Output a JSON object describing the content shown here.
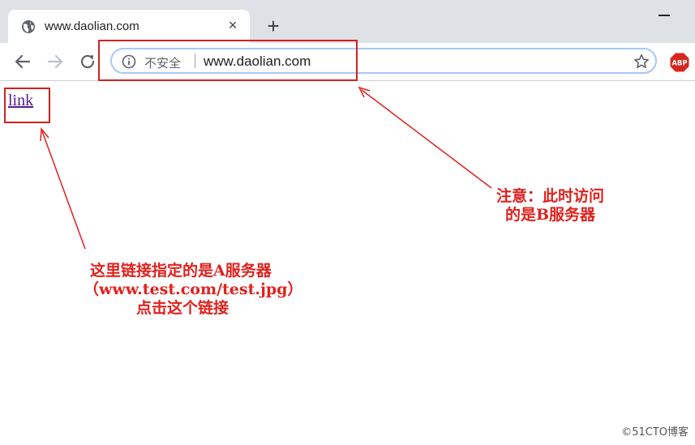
{
  "tab": {
    "title": "www.daolian.com",
    "close": "×"
  },
  "newtab": {
    "label": "+"
  },
  "omnibox": {
    "security_label": "不安全",
    "url": "www.daolian.com"
  },
  "extension": {
    "abp": "ABP"
  },
  "page": {
    "link_text": "link"
  },
  "annotations": {
    "note_right_line1": "注意：此时访问",
    "note_right_line2": "的是B服务器",
    "note_left_line1": "这里链接指定的是A服务器",
    "note_left_line2": "（www.test.com/test.jpg）",
    "note_left_line3": "点击这个链接"
  },
  "watermark": "©51CTO博客",
  "colors": {
    "annotation_red": "#e0211d",
    "box_red": "#d42020",
    "link_visited": "#551a8b"
  }
}
